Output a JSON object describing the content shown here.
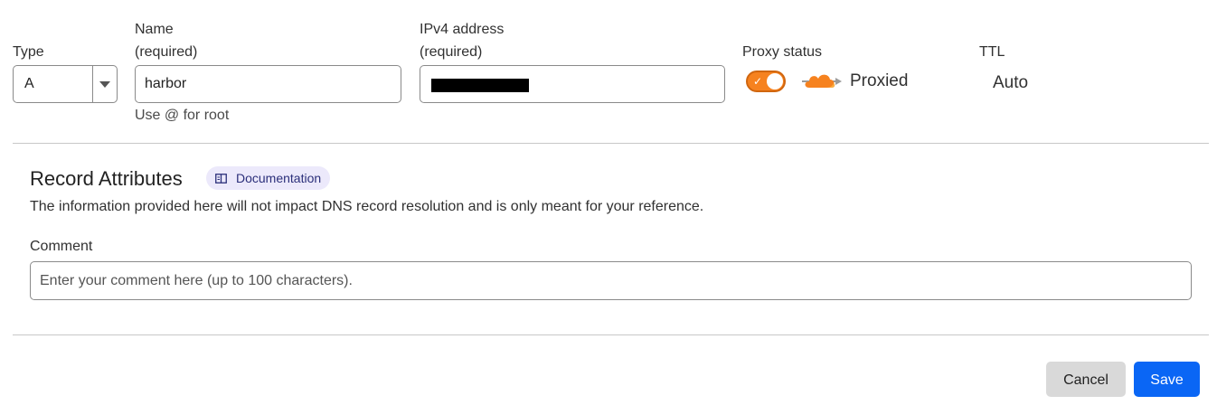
{
  "type_field": {
    "label": "Type",
    "value": "A"
  },
  "name_field": {
    "label_line1": "Name",
    "label_line2": "(required)",
    "value": "harbor",
    "help": "Use @ for root"
  },
  "ipv4_field": {
    "label_line1": "IPv4 address",
    "label_line2": "(required)"
  },
  "proxy": {
    "label": "Proxy status",
    "enabled": true,
    "status_text": "Proxied",
    "accent": "#f6821f"
  },
  "ttl": {
    "label": "TTL",
    "value": "Auto"
  },
  "record_attributes": {
    "title": "Record Attributes",
    "doc_badge": "Documentation",
    "description": "The information provided here will not impact DNS record resolution and is only meant for your reference."
  },
  "comment": {
    "label": "Comment",
    "placeholder": "Enter your comment here (up to 100 characters)."
  },
  "actions": {
    "cancel": "Cancel",
    "save": "Save",
    "save_color": "#0a66f5"
  }
}
